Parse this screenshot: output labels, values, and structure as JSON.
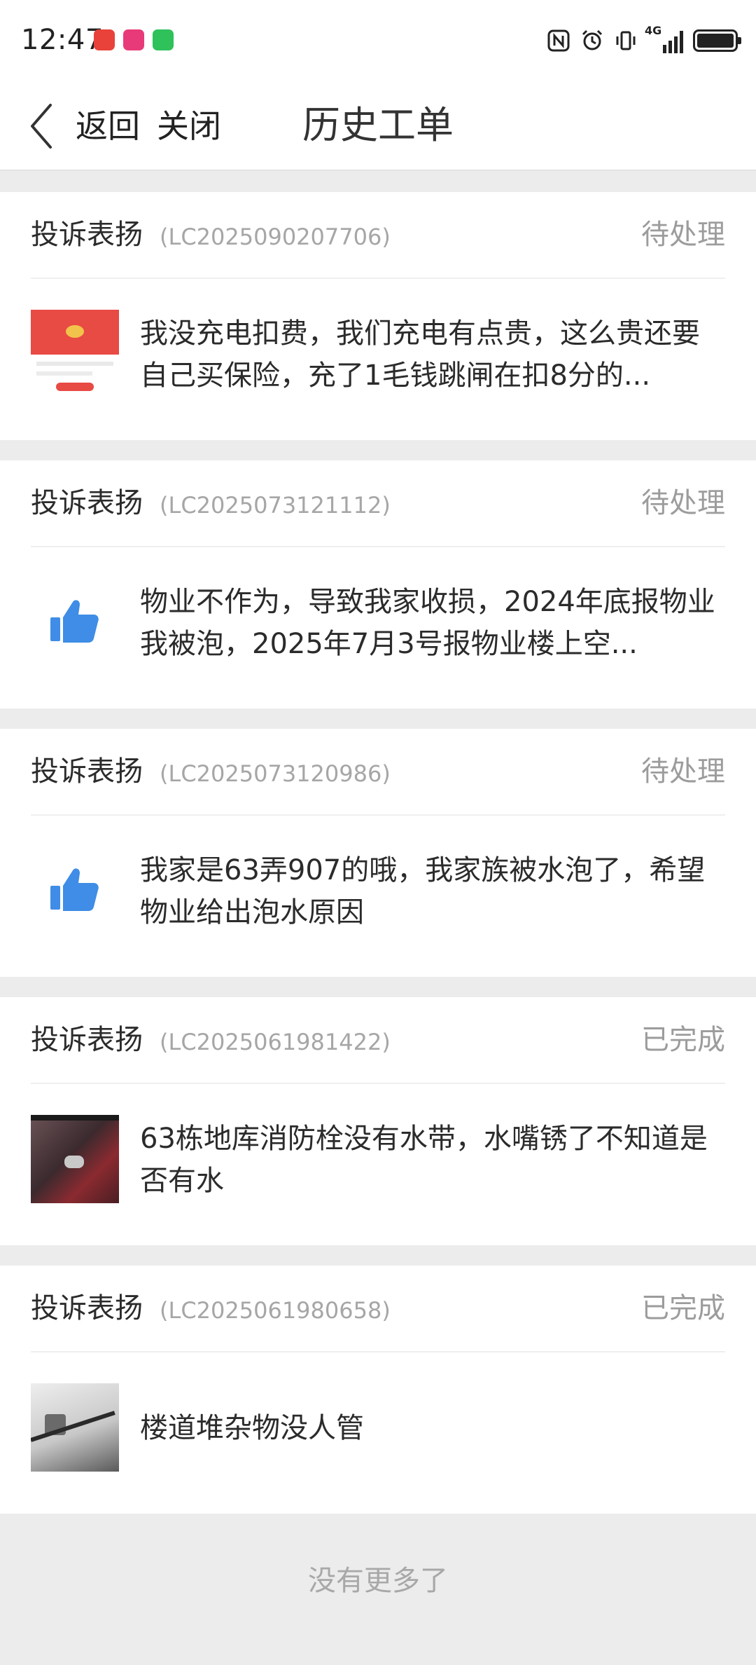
{
  "status_bar": {
    "time": "12:47",
    "network_label": "4G",
    "icons": [
      "nfc-icon",
      "alarm-icon",
      "vibrate-icon",
      "signal-icon",
      "battery-icon"
    ]
  },
  "header": {
    "back_label": "返回",
    "close_label": "关闭",
    "title": "历史工单"
  },
  "tickets": [
    {
      "type": "投诉表扬",
      "code": "(LC2025090207706)",
      "status": "待处理",
      "thumb": "screenshot",
      "text": "我没充电扣费，我们充电有点贵，这么贵还要自己买保险，充了1毛钱跳闸在扣8分的..."
    },
    {
      "type": "投诉表扬",
      "code": "(LC2025073121112)",
      "status": "待处理",
      "thumb": "thumbs-up-icon",
      "text": "物业不作为，导致我家收损，2024年底报物业我被泡，2025年7月3号报物业楼上空..."
    },
    {
      "type": "投诉表扬",
      "code": "(LC2025073120986)",
      "status": "待处理",
      "thumb": "thumbs-up-icon",
      "text": "我家是63弄907的哦，我家族被水泡了，希望物业给出泡水原因"
    },
    {
      "type": "投诉表扬",
      "code": "(LC2025061981422)",
      "status": "已完成",
      "thumb": "photo",
      "text": "63栋地库消防栓没有水带，水嘴锈了不知道是否有水"
    },
    {
      "type": "投诉表扬",
      "code": "(LC2025061980658)",
      "status": "已完成",
      "thumb": "photo",
      "text": "楼道堆杂物没人管"
    }
  ],
  "footer": {
    "no_more": "没有更多了"
  },
  "colors": {
    "like_blue": "#3f8de6",
    "page_bg": "#ececec",
    "status_grey": "#9c9c9c"
  }
}
